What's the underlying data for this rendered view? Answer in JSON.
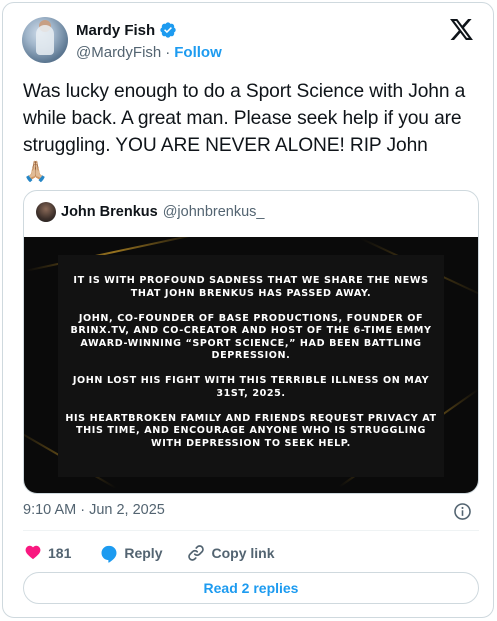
{
  "author": {
    "name": "Mardy Fish",
    "handle": "@MardyFish",
    "separator": "·",
    "follow_label": "Follow"
  },
  "tweet": {
    "text": "Was lucky enough to do a Sport Science with John a while back. A great man. Please seek help if you are struggling. YOU ARE NEVER ALONE! RIP John",
    "emoji": "🙏🏼"
  },
  "quote": {
    "name": "John Brenkus",
    "handle": "@johnbrenkus_",
    "image_text": [
      "IT IS WITH PROFOUND SADNESS THAT WE SHARE THE NEWS THAT JOHN BRENKUS HAS PASSED AWAY.",
      "JOHN, CO-FOUNDER OF BASE PRODUCTIONS, FOUNDER OF BRINX.TV, AND CO-CREATOR AND HOST OF THE 6-TIME EMMY AWARD-WINNING “SPORT SCIENCE,” HAD BEEN BATTLING DEPRESSION.",
      "JOHN LOST HIS FIGHT WITH THIS TERRIBLE ILLNESS ON MAY 31ST, 2025.",
      "HIS HEARTBROKEN FAMILY AND FRIENDS REQUEST PRIVACY AT THIS TIME, AND ENCOURAGE ANYONE WHO IS STRUGGLING WITH DEPRESSION TO SEEK HELP."
    ]
  },
  "timestamp": "9:10 AM · Jun 2, 2025",
  "actions": {
    "like_count": "181",
    "reply_label": "Reply",
    "copy_label": "Copy link"
  },
  "replies_button": "Read 2 replies",
  "colors": {
    "accent": "#1d9bf0",
    "like": "#f91880",
    "muted": "#536471"
  }
}
